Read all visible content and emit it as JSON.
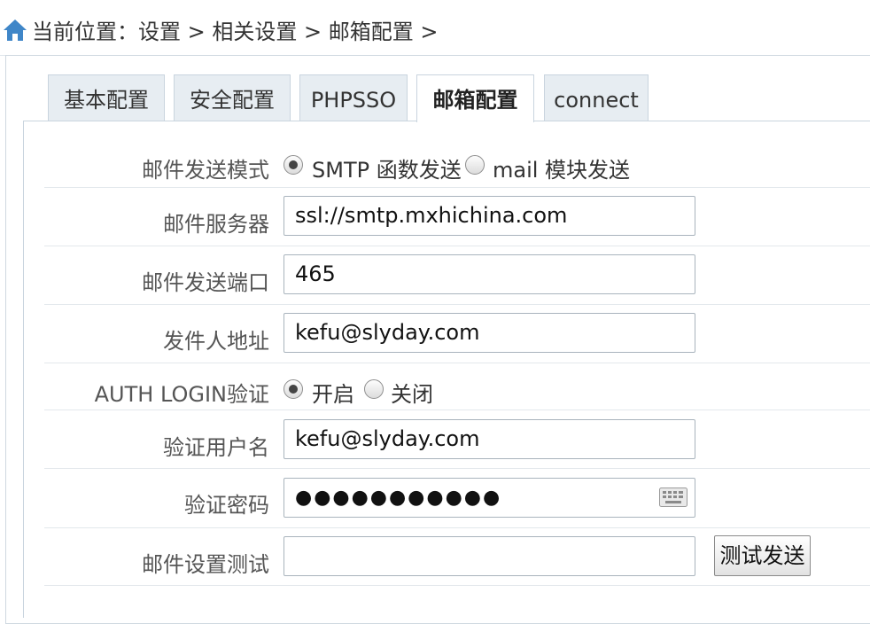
{
  "breadcrumb": {
    "prefix": "当前位置：",
    "items": [
      "设置",
      "相关设置",
      "邮箱配置"
    ],
    "separator": ">"
  },
  "tabs": [
    {
      "label": "基本配置",
      "active": false
    },
    {
      "label": "安全配置",
      "active": false
    },
    {
      "label": "PHPSSO",
      "active": false
    },
    {
      "label": "邮箱配置",
      "active": true
    },
    {
      "label": "connect",
      "active": false
    }
  ],
  "form": {
    "send_mode": {
      "label": "邮件发送模式",
      "options": [
        "SMTP 函数发送",
        "mail 模块发送"
      ],
      "selected": "SMTP 函数发送"
    },
    "server": {
      "label": "邮件服务器",
      "value": "ssl://smtp.mxhichina.com"
    },
    "port": {
      "label": "邮件发送端口",
      "value": "465"
    },
    "from_address": {
      "label": "发件人地址",
      "value": "kefu@slyday.com"
    },
    "auth_login": {
      "label": "AUTH LOGIN验证",
      "options": [
        "开启",
        "关闭"
      ],
      "selected": "开启"
    },
    "auth_user": {
      "label": "验证用户名",
      "value": "kefu@slyday.com"
    },
    "auth_password": {
      "label": "验证密码",
      "value": "●●●●●●●●●●●"
    },
    "test": {
      "label": "邮件设置测试",
      "value": "",
      "button_label": "测试发送"
    }
  },
  "colors": {
    "home_icon": "#3f86c8",
    "tab_bg": "#e7edf2",
    "border": "#c9d4de"
  }
}
